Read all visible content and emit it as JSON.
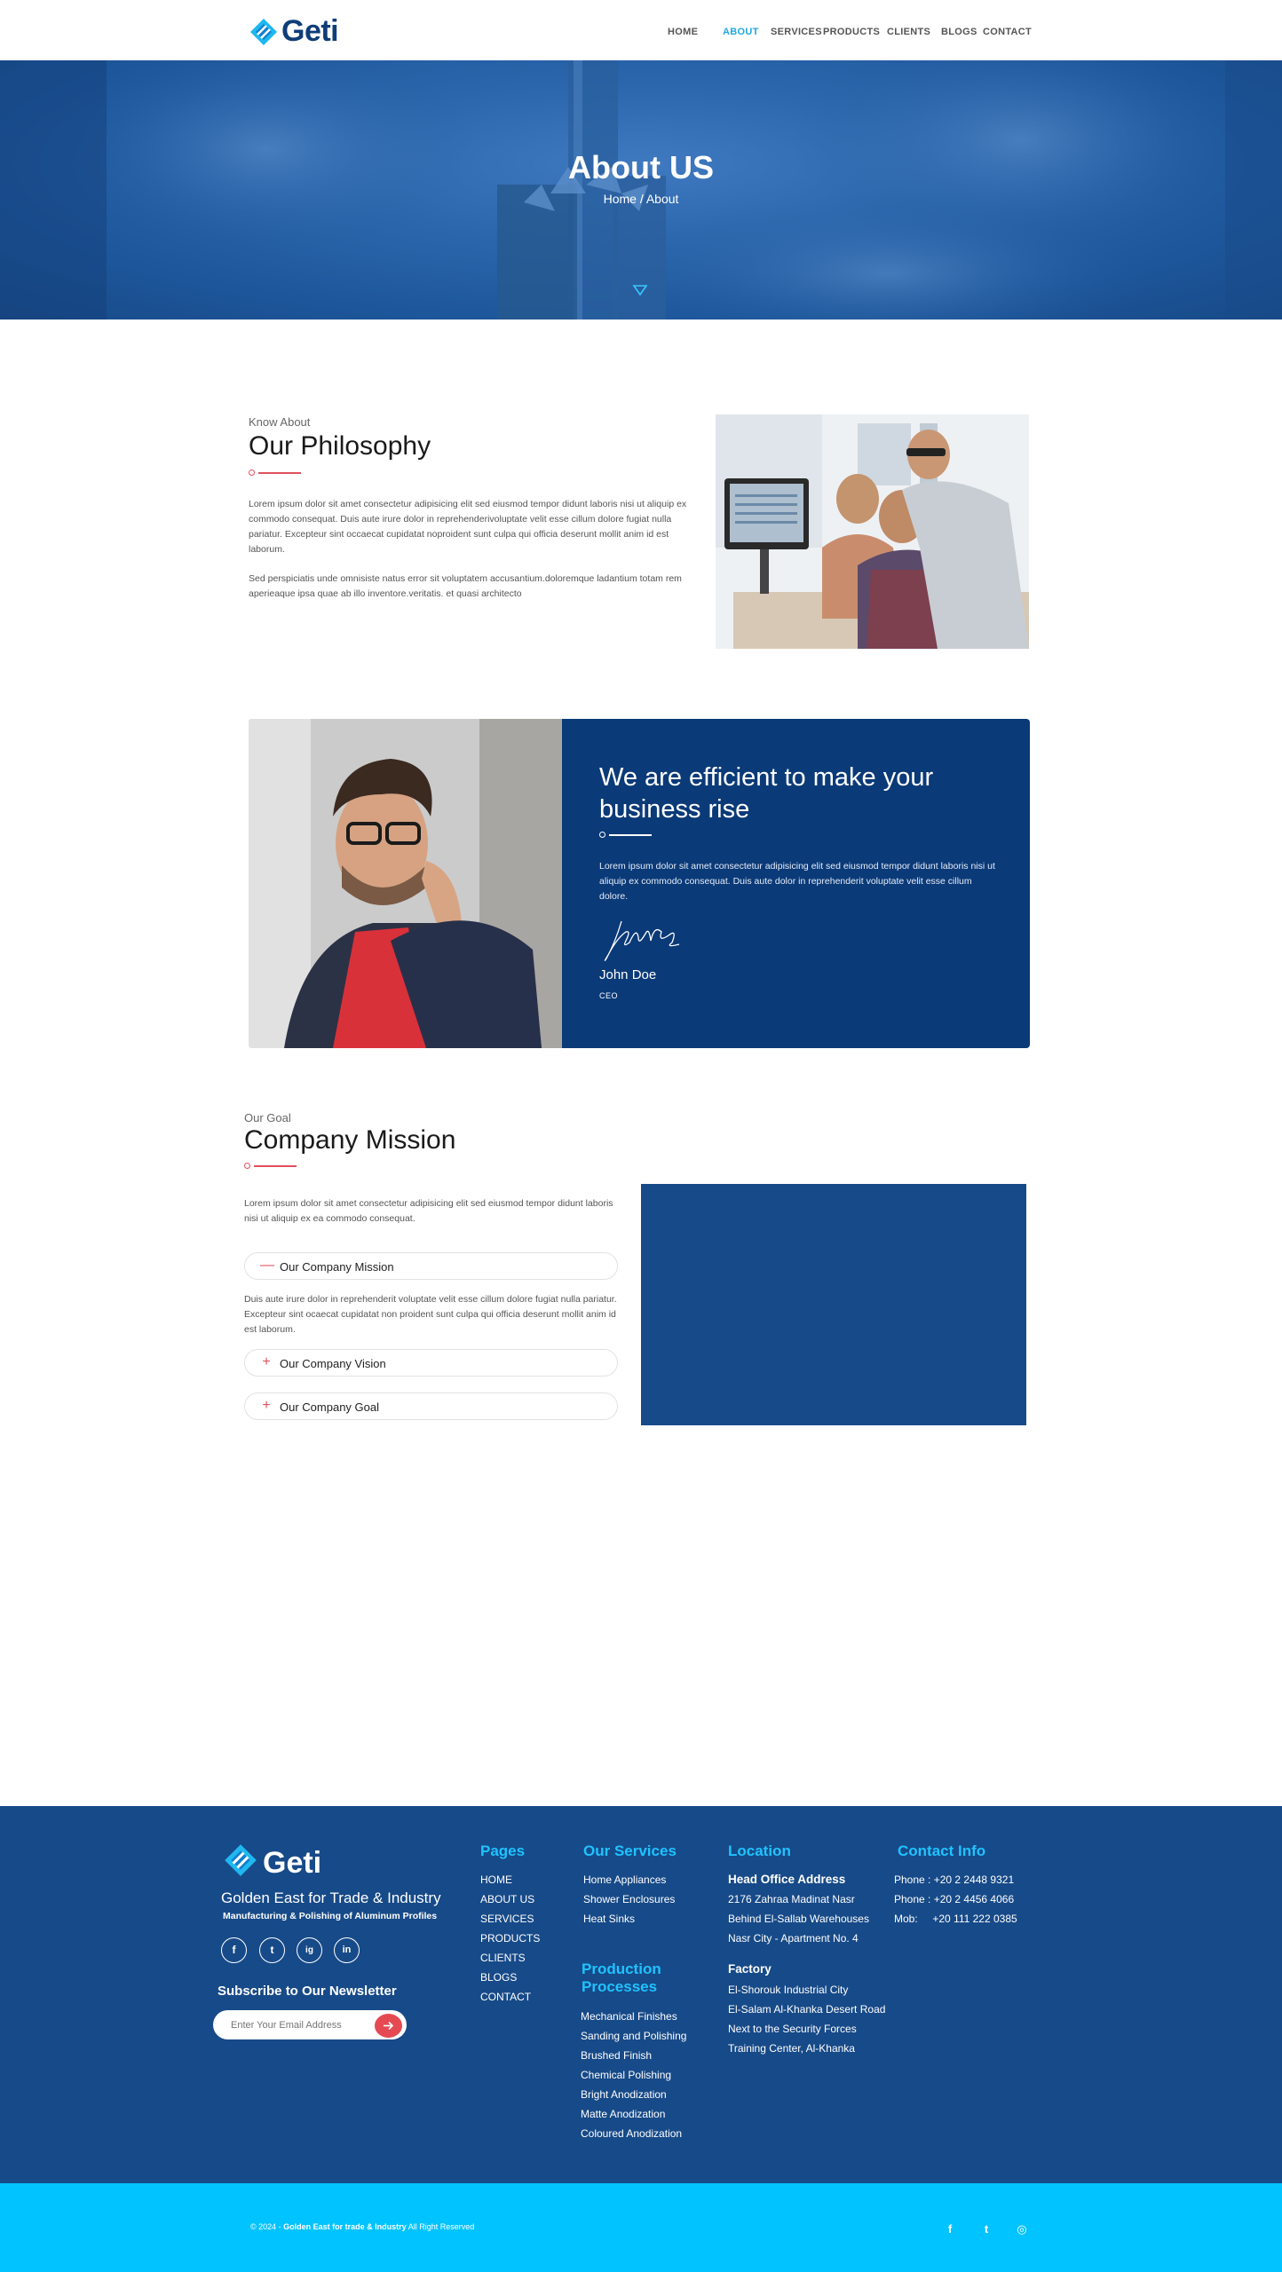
{
  "header": {
    "brand": "Geti",
    "nav": [
      {
        "label": "HOME"
      },
      {
        "label": "ABOUT"
      },
      {
        "label": "SERVICES"
      },
      {
        "label": "PRODUCTS"
      },
      {
        "label": "CLIENTS"
      },
      {
        "label": "BLOGS"
      },
      {
        "label": "CONTACT"
      }
    ],
    "active_nav": "ABOUT"
  },
  "hero": {
    "title": "About US",
    "breadcrumb": "Home / About"
  },
  "philosophy": {
    "eyebrow": "Know About",
    "title": "Our Philosophy",
    "paragraph1": "Lorem ipsum dolor sit amet consectetur adipisicing elit sed eiusmod tempor didunt laboris nisi ut aliquip ex commodo consequat. Duis aute irure dolor in reprehenderivoluptate velit esse cillum dolore fugiat nulla pariatur. Excepteur sint occaecat cupidatat noproident sunt culpa qui officia deserunt mollit anim id est laborum.",
    "paragraph2": "Sed perspiciatis unde omnisiste natus error sit voluptatem accusantium.doloremque ladantium totam rem aperieaque ipsa quae ab illo inventore.veritatis. et quasi architecto"
  },
  "efficient": {
    "title": "We are efficient to make your business rise",
    "paragraph": "Lorem ipsum dolor sit amet consectetur adipisicing elit sed eiusmod tempor didunt laboris nisi ut aliquip ex commodo consequat. Duis aute dolor in reprehenderit voluptate velit esse cillum dolore.",
    "name": "John Doe",
    "role": "CEO"
  },
  "mission": {
    "eyebrow": "Our Goal",
    "title": "Company Mission",
    "intro": "Lorem ipsum dolor sit amet consectetur adipisicing elit sed eiusmod tempor didunt laboris nisi ut aliquip ex ea commodo consequat.",
    "accordion": [
      {
        "label": "Our Company Mission",
        "sign": "—",
        "expanded": true
      },
      {
        "label": "Our Company Vision",
        "sign": "+",
        "expanded": false
      },
      {
        "label": "Our Company Goal",
        "sign": "+",
        "expanded": false
      }
    ],
    "expanded_text": "Duis aute irure dolor in reprehenderit voluptate velit esse cillum dolore fugiat nulla pariatur. Excepteur sint ocaecat cupidatat non proident sunt culpa qui officia deserunt mollit anim id est laborum."
  },
  "footer": {
    "brand": "Geti",
    "company": "Golden East for Trade & Industry",
    "tagline": "Manufacturing & Polishing of Aluminum Profiles",
    "social": [
      "f",
      "t",
      "ig",
      "in"
    ],
    "newsletter_title": "Subscribe to Our Newsletter",
    "email_placeholder": "Enter Your Email Address",
    "pages_title": "Pages",
    "pages": [
      "HOME",
      "ABOUT US",
      "SERVICES",
      "PRODUCTS",
      "CLIENTS",
      "BLOGS",
      "CONTACT"
    ],
    "services_title": "Our Services",
    "services": [
      "Home Appliances",
      "Shower Enclosures",
      "Heat Sinks"
    ],
    "processes_title_line1": "Production",
    "processes_title_line2": "Processes",
    "processes": [
      "Mechanical Finishes",
      "Sanding and Polishing",
      "Brushed Finish",
      "Chemical Polishing",
      "Bright Anodization",
      "Matte Anodization",
      "Coloured Anodization"
    ],
    "location_title": "Location",
    "head_office_title": "Head Office Address",
    "head_office": [
      "2176 Zahraa Madinat Nasr",
      "Behind El-Sallab Warehouses",
      "Nasr City - Apartment No. 4"
    ],
    "factory_title": "Factory",
    "factory": [
      "El-Shorouk Industrial City",
      "El-Salam Al-Khanka Desert Road",
      "Next to the Security Forces",
      "Training Center, Al-Khanka"
    ],
    "contact_title": "Contact Info",
    "contact": [
      "Phone : +20 2 2448 9321",
      "Phone : +20 2 4456 4066",
      "Mob:     +20 111 222 0385"
    ],
    "copyright_prefix": "© 2024 - ",
    "copyright_company": "Golden East for trade & Industry",
    "copyright_suffix": " All Right Reserved",
    "bottom_social": [
      "f",
      "t",
      "◎"
    ]
  },
  "colors": {
    "brand_blue": "#0f3d78",
    "accent_cyan": "#1fa8e0",
    "panel_navy": "#0b3a78",
    "footer_blue": "#174a88",
    "copyright_cyan": "#00c3ff",
    "accent_red": "#e2505c"
  },
  "icons": {
    "logo": "diamond-logo-icon",
    "hero_arrow": "down-triangle-icon",
    "divider": "circle-line-divider",
    "newsletter_submit": "arrow-right-icon"
  }
}
